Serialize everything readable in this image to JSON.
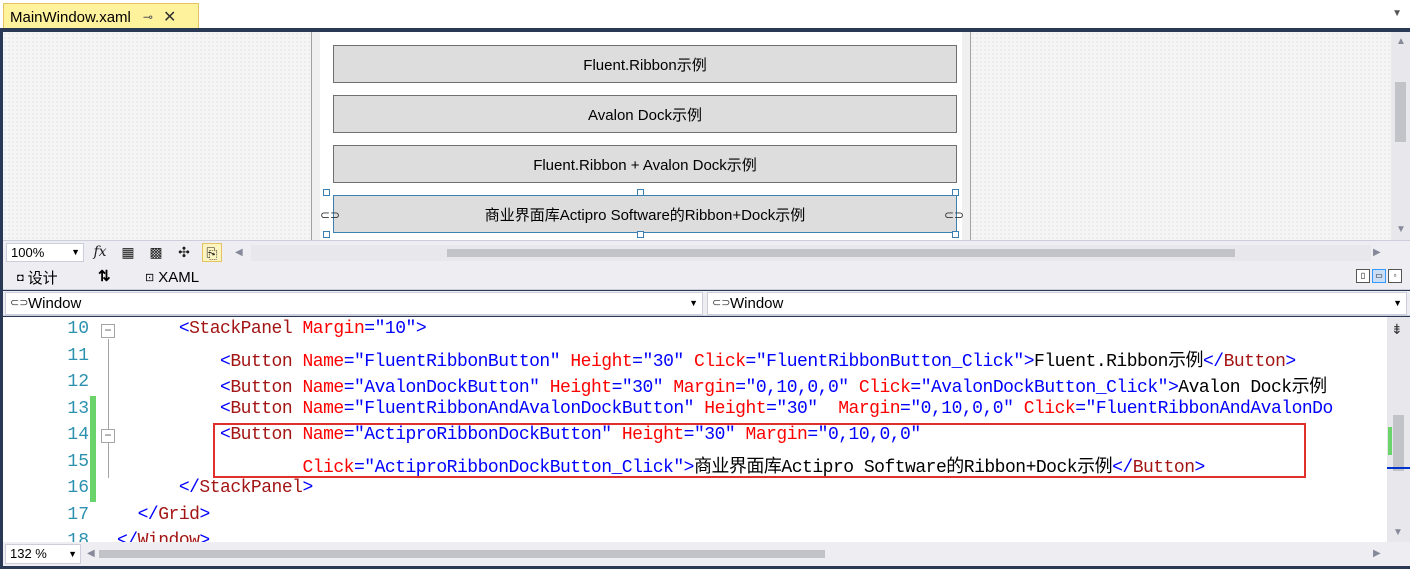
{
  "document_tab": {
    "title": "MainWindow.xaml",
    "pin_icon": "pin-icon",
    "close_glyph": "✕"
  },
  "designer": {
    "buttons": [
      "Fluent.Ribbon示例",
      "Avalon Dock示例",
      "Fluent.Ribbon + Avalon Dock示例",
      "商业界面库Actipro Software的Ribbon+Dock示例"
    ],
    "zoom": "100%"
  },
  "split_tabs": {
    "design_label": "设计",
    "swap_label": "⇅",
    "xaml_label": "XAML"
  },
  "nav_bar": {
    "left_value": "Window",
    "right_value": "Window"
  },
  "code": {
    "line_numbers": [
      "10",
      "11",
      "12",
      "13",
      "14",
      "15",
      "16",
      "17",
      "18"
    ],
    "lines": [
      {
        "indent": "      ",
        "segments": [
          [
            "punc",
            "<"
          ],
          [
            "tag",
            "StackPanel"
          ],
          [
            "txt",
            " "
          ],
          [
            "attr",
            "Margin"
          ],
          [
            "punc",
            "="
          ],
          [
            "val",
            "\"10\""
          ],
          [
            "punc",
            ">"
          ]
        ]
      },
      {
        "indent": "          ",
        "segments": [
          [
            "punc",
            "<"
          ],
          [
            "tag",
            "Button"
          ],
          [
            "txt",
            " "
          ],
          [
            "attr",
            "Name"
          ],
          [
            "punc",
            "="
          ],
          [
            "val",
            "\"FluentRibbonButton\""
          ],
          [
            "txt",
            " "
          ],
          [
            "attr",
            "Height"
          ],
          [
            "punc",
            "="
          ],
          [
            "val",
            "\"30\""
          ],
          [
            "txt",
            " "
          ],
          [
            "attr",
            "Click"
          ],
          [
            "punc",
            "="
          ],
          [
            "val",
            "\"FluentRibbonButton_Click\""
          ],
          [
            "punc",
            ">"
          ],
          [
            "txt",
            "Fluent.Ribbon示例"
          ],
          [
            "punc",
            "</"
          ],
          [
            "tag",
            "Button"
          ],
          [
            "punc",
            ">"
          ]
        ]
      },
      {
        "indent": "          ",
        "segments": [
          [
            "punc",
            "<"
          ],
          [
            "tag",
            "Button"
          ],
          [
            "txt",
            " "
          ],
          [
            "attr",
            "Name"
          ],
          [
            "punc",
            "="
          ],
          [
            "val",
            "\"AvalonDockButton\""
          ],
          [
            "txt",
            " "
          ],
          [
            "attr",
            "Height"
          ],
          [
            "punc",
            "="
          ],
          [
            "val",
            "\"30\""
          ],
          [
            "txt",
            " "
          ],
          [
            "attr",
            "Margin"
          ],
          [
            "punc",
            "="
          ],
          [
            "val",
            "\"0,10,0,0\""
          ],
          [
            "txt",
            " "
          ],
          [
            "attr",
            "Click"
          ],
          [
            "punc",
            "="
          ],
          [
            "val",
            "\"AvalonDockButton_Click\""
          ],
          [
            "punc",
            ">"
          ],
          [
            "txt",
            "Avalon Dock示例"
          ]
        ]
      },
      {
        "indent": "          ",
        "segments": [
          [
            "punc",
            "<"
          ],
          [
            "tag",
            "Button"
          ],
          [
            "txt",
            " "
          ],
          [
            "attr",
            "Name"
          ],
          [
            "punc",
            "="
          ],
          [
            "val",
            "\"FluentRibbonAndAvalonDockButton\""
          ],
          [
            "txt",
            " "
          ],
          [
            "attr",
            "Height"
          ],
          [
            "punc",
            "="
          ],
          [
            "val",
            "\"30\""
          ],
          [
            "txt",
            "  "
          ],
          [
            "attr",
            "Margin"
          ],
          [
            "punc",
            "="
          ],
          [
            "val",
            "\"0,10,0,0\""
          ],
          [
            "txt",
            " "
          ],
          [
            "attr",
            "Click"
          ],
          [
            "punc",
            "="
          ],
          [
            "val",
            "\"FluentRibbonAndAvalonDo"
          ]
        ]
      },
      {
        "indent": "          ",
        "segments": [
          [
            "punc",
            "<"
          ],
          [
            "tag",
            "Button"
          ],
          [
            "txt",
            " "
          ],
          [
            "attr",
            "Name"
          ],
          [
            "punc",
            "="
          ],
          [
            "val",
            "\"ActiproRibbonDockButton\""
          ],
          [
            "txt",
            " "
          ],
          [
            "attr",
            "Height"
          ],
          [
            "punc",
            "="
          ],
          [
            "val",
            "\"30\""
          ],
          [
            "txt",
            " "
          ],
          [
            "attr",
            "Margin"
          ],
          [
            "punc",
            "="
          ],
          [
            "val",
            "\"0,10,0,0\""
          ]
        ]
      },
      {
        "indent": "                  ",
        "segments": [
          [
            "attr",
            "Click"
          ],
          [
            "punc",
            "="
          ],
          [
            "val",
            "\"ActiproRibbonDockButton_Click\""
          ],
          [
            "punc",
            ">"
          ],
          [
            "txt",
            "商业界面库Actipro Software的Ribbon+Dock示例"
          ],
          [
            "punc",
            "</"
          ],
          [
            "tag",
            "Button"
          ],
          [
            "punc",
            ">"
          ]
        ]
      },
      {
        "indent": "      ",
        "segments": [
          [
            "punc",
            "</"
          ],
          [
            "tag",
            "StackPanel"
          ],
          [
            "punc",
            ">"
          ]
        ]
      },
      {
        "indent": "  ",
        "segments": [
          [
            "punc",
            "</"
          ],
          [
            "tag",
            "Grid"
          ],
          [
            "punc",
            ">"
          ]
        ]
      },
      {
        "indent": "",
        "segments": [
          [
            "punc",
            "</"
          ],
          [
            "tag",
            "Window"
          ],
          [
            "punc",
            ">"
          ]
        ]
      }
    ],
    "zoom": "132 %"
  },
  "colors": {
    "tag": "#a31515",
    "attribute": "#ff0000",
    "value": "#0000ff",
    "line_number": "#2b91af",
    "change_marker": "#6ad46a",
    "highlight_box": "#e0302c",
    "active_tab": "#fff29d"
  },
  "icons": {
    "toolbar": [
      "fx-icon",
      "grid-icon",
      "snap-grid-icon",
      "snap-lines-icon",
      "effects-icon"
    ]
  }
}
